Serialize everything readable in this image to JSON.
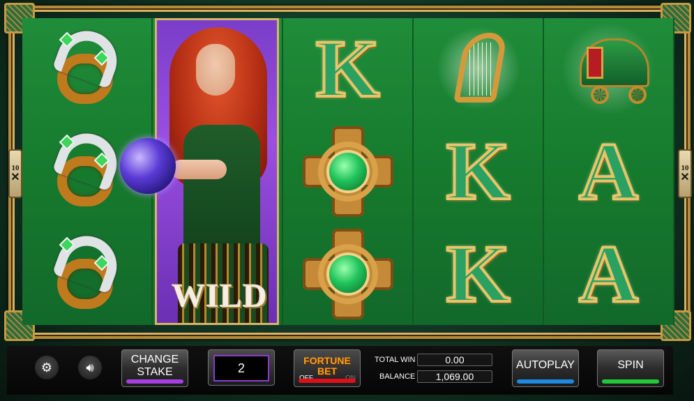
{
  "reels": {
    "side_badge_left": {
      "top": "10",
      "bottom": "✕"
    },
    "side_badge_right": {
      "top": "10",
      "bottom": "✕"
    },
    "wild_label": "WILD",
    "columns": [
      [
        "horseshoe-ring",
        "horseshoe-ring",
        "horseshoe-ring"
      ],
      [
        "wild-fortune-teller",
        "wild-fortune-teller",
        "wild-fortune-teller"
      ],
      [
        "K",
        "celtic-cross",
        "celtic-cross"
      ],
      [
        "harp",
        "K",
        "K"
      ],
      [
        "caravan",
        "A",
        "A"
      ]
    ],
    "letters": {
      "col3_row0": "K",
      "col4_row1": "K",
      "col4_row2": "K",
      "col5_row1": "A",
      "col5_row2": "A"
    }
  },
  "controls": {
    "settings_icon": "gear-icon",
    "sound_icon": "speaker-icon",
    "change_stake": {
      "line1": "CHANGE",
      "line2": "STAKE",
      "accent": "#a83fe0"
    },
    "stake_value": "2",
    "fortune_bet": {
      "line1": "FORTUNE",
      "line2": "BET",
      "off": "OFF",
      "on": "ON",
      "accent": "#e0101a"
    },
    "total_win_label": "TOTAL WIN",
    "total_win_value": "0.00",
    "balance_label": "BALANCE",
    "balance_value": "1,069.00",
    "autoplay": {
      "label": "AUTOPLAY",
      "accent": "#1f88e0"
    },
    "spin": {
      "label": "SPIN",
      "accent": "#20c83a"
    }
  }
}
